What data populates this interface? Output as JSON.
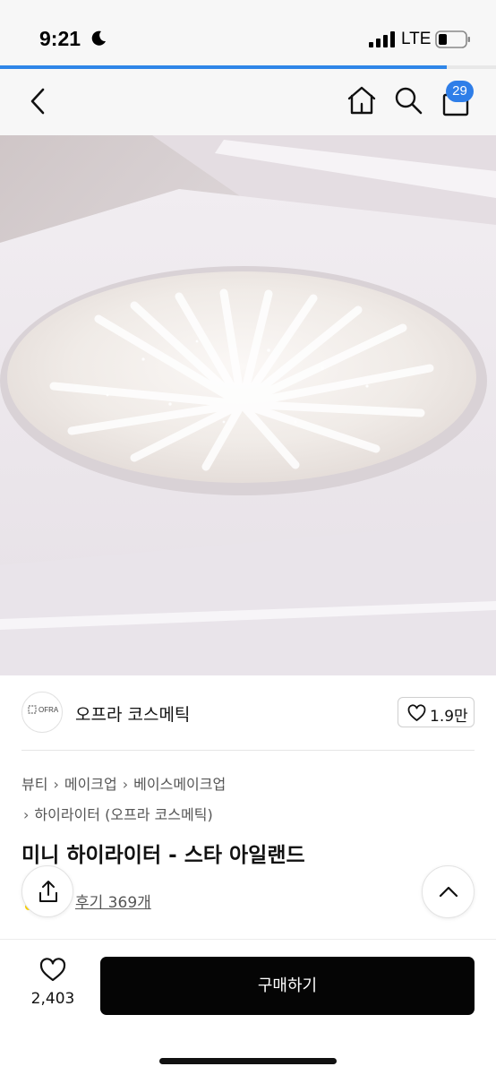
{
  "status_bar": {
    "time": "9:21",
    "network": "LTE",
    "icons": [
      "moon-icon",
      "signal-icon",
      "battery-icon"
    ]
  },
  "page_load_progress": 0.9,
  "header": {
    "icons": [
      "chevron-left-icon",
      "home-icon",
      "search-icon",
      "shopping-bag-icon"
    ],
    "bag_count": "29",
    "accent_color": "#2f7ee8"
  },
  "brand": {
    "logo_text": "OFRA",
    "name": "오프라 코스메틱",
    "likes": "1.9만"
  },
  "breadcrumb": {
    "items": [
      "뷰티",
      "메이크업",
      "베이스메이크업",
      "하이라이터 (오프라 코스메틱)"
    ]
  },
  "product": {
    "title": "미니 하이라이터 - 스타 아일랜드",
    "reviews": "후기 369개"
  },
  "bottom_bar": {
    "wish_count": "2,403",
    "buy_label": "구매하기"
  }
}
